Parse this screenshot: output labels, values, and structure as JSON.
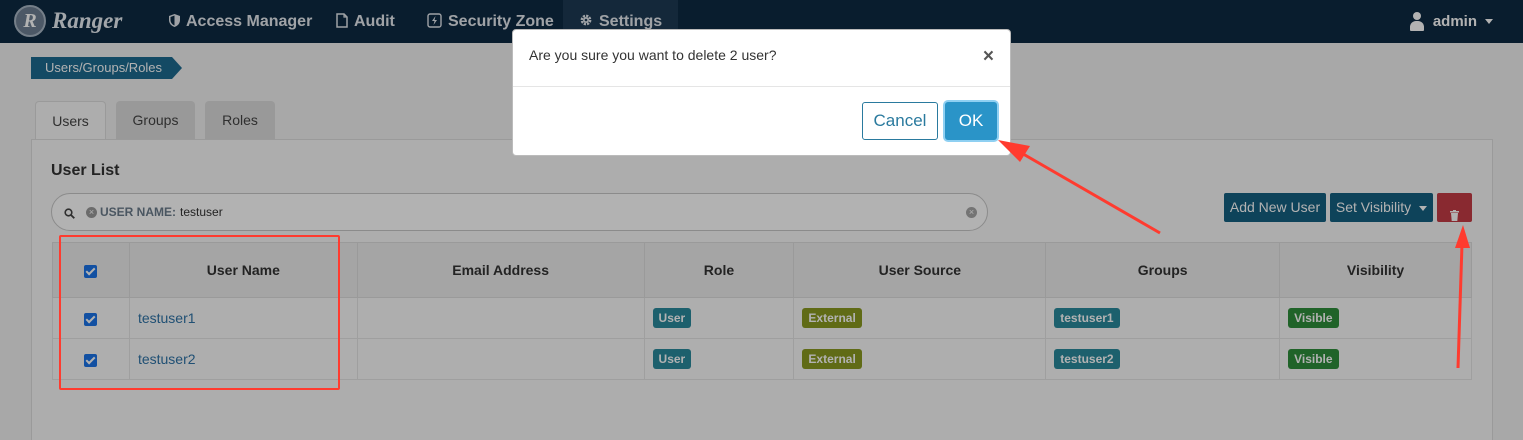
{
  "navbar": {
    "brand": "Ranger",
    "brand_initial": "R",
    "items": [
      {
        "label": "Access Manager",
        "icon": "shield-icon"
      },
      {
        "label": "Audit",
        "icon": "file-icon"
      },
      {
        "label": "Security Zone",
        "icon": "bolt-icon"
      },
      {
        "label": "Settings",
        "icon": "gear-icon"
      }
    ],
    "user": "admin"
  },
  "breadcrumb": "Users/Groups/Roles",
  "tabs": [
    {
      "label": "Users",
      "active": true
    },
    {
      "label": "Groups",
      "active": false
    },
    {
      "label": "Roles",
      "active": false
    }
  ],
  "panel": {
    "title": "User List",
    "search": {
      "chip_label": "USER NAME:",
      "chip_value": "testuser"
    },
    "buttons": {
      "add_user": "Add New User",
      "set_visibility": "Set Visibility"
    }
  },
  "table": {
    "headers": [
      "User Name",
      "Email Address",
      "Role",
      "User Source",
      "Groups",
      "Visibility"
    ],
    "rows": [
      {
        "user_name": "testuser1",
        "email": "",
        "role": "User",
        "source": "External",
        "group": "testuser1",
        "visibility": "Visible",
        "checked": true
      },
      {
        "user_name": "testuser2",
        "email": "",
        "role": "User",
        "source": "External",
        "group": "testuser2",
        "visibility": "Visible",
        "checked": true
      }
    ]
  },
  "modal": {
    "message": "Are you sure you want to delete 2 user?",
    "close": "×",
    "cancel": "Cancel",
    "ok": "OK"
  },
  "colors": {
    "navbar": "#0d2a42",
    "primary": "#156082",
    "danger": "#c53b45",
    "annotation": "#ff3b2f"
  }
}
